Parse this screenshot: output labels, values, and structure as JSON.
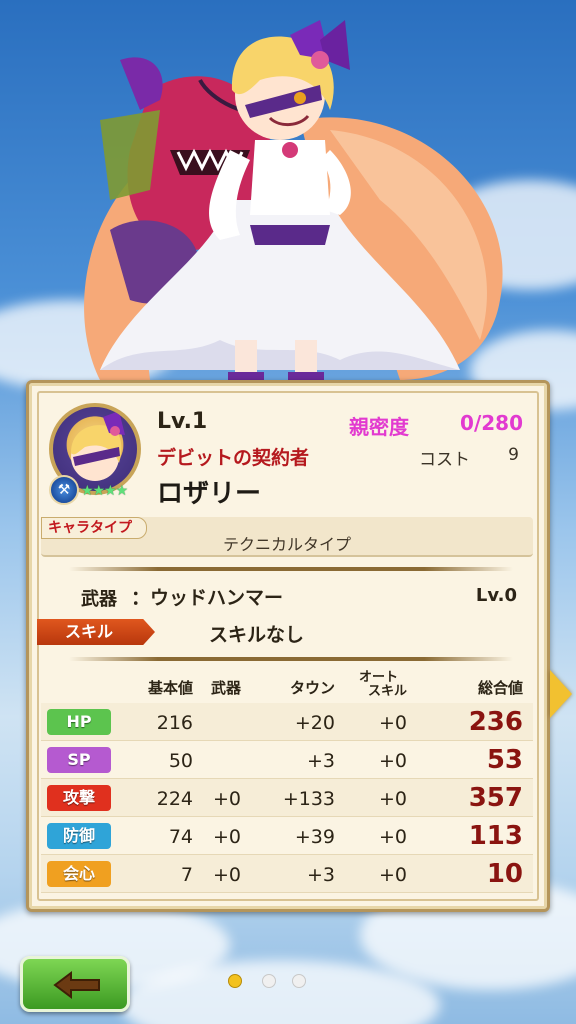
{
  "character": {
    "level": "Lv.1",
    "affinity_label": "親密度",
    "affinity_value": "0/280",
    "title": "デビットの契約者",
    "cost_label": "コスト",
    "cost_value": "9",
    "name": "ロザリー",
    "rarity_stars": "★★★★",
    "element_icon": "hammer-element-icon"
  },
  "type": {
    "label": "キャラタイプ",
    "value": "テクニカルタイプ"
  },
  "weapon": {
    "label": "武器",
    "value": "：ウッドハンマー",
    "level": "Lv.0"
  },
  "skill": {
    "label": "スキル",
    "value": "スキルなし"
  },
  "stats": {
    "headers": {
      "base": "基本値",
      "weapon": "武器",
      "town": "タウン",
      "auto_skill_1": "オート",
      "auto_skill_2": "スキル",
      "total": "総合値"
    },
    "rows": [
      {
        "label": "HP",
        "color": "#5cc44e",
        "base": "216",
        "weapon": "",
        "town": "+20",
        "auto": "+0",
        "total": "236"
      },
      {
        "label": "SP",
        "color": "#b55ad0",
        "base": "50",
        "weapon": "",
        "town": "+3",
        "auto": "+0",
        "total": "53"
      },
      {
        "label": "攻撃",
        "color": "#e0301e",
        "base": "224",
        "weapon": "+0",
        "town": "+133",
        "auto": "+0",
        "total": "357"
      },
      {
        "label": "防御",
        "color": "#2fa4d8",
        "base": "74",
        "weapon": "+0",
        "town": "+39",
        "auto": "+0",
        "total": "113"
      },
      {
        "label": "会心",
        "color": "#f0a020",
        "base": "7",
        "weapon": "+0",
        "town": "+3",
        "auto": "+0",
        "total": "10"
      }
    ]
  },
  "pager": {
    "pages": 3,
    "current": 1
  },
  "navigation": {
    "back_icon": "back-arrow-icon",
    "next_icon": "next-arrow-icon"
  }
}
